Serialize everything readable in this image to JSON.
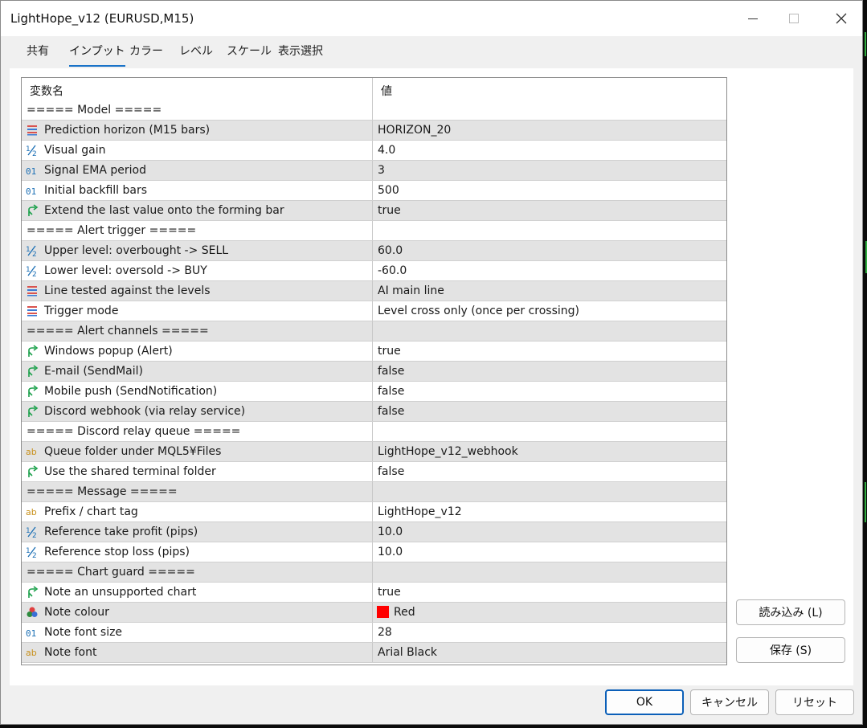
{
  "window": {
    "title": "LightHope_v12 (EURUSD,M15)"
  },
  "tabs": [
    {
      "label": "共有"
    },
    {
      "label": "インプット"
    },
    {
      "label": "カラー"
    },
    {
      "label": "レベル"
    },
    {
      "label": "スケール"
    },
    {
      "label": "表示選択"
    }
  ],
  "active_tab": "インプット",
  "table": {
    "header": {
      "name": "変数名",
      "value": "値"
    },
    "rows": [
      {
        "type": "group",
        "name": "===== Model =====",
        "value": ""
      },
      {
        "type": "enum",
        "name": "Prediction horizon (M15 bars)",
        "value": "HORIZON_20"
      },
      {
        "type": "double",
        "name": "Visual gain",
        "value": "4.0"
      },
      {
        "type": "int",
        "name": "Signal EMA period",
        "value": "3"
      },
      {
        "type": "int",
        "name": "Initial backfill bars",
        "value": "500"
      },
      {
        "type": "bool",
        "name": "Extend the last value onto the forming bar",
        "value": "true"
      },
      {
        "type": "group",
        "name": "===== Alert trigger =====",
        "value": ""
      },
      {
        "type": "double",
        "name": "Upper level: overbought -> SELL",
        "value": "60.0"
      },
      {
        "type": "double",
        "name": "Lower level: oversold -> BUY",
        "value": "-60.0"
      },
      {
        "type": "enum",
        "name": "Line tested against the levels",
        "value": "AI main line"
      },
      {
        "type": "enum",
        "name": "Trigger mode",
        "value": "Level cross only (once per crossing)"
      },
      {
        "type": "group",
        "name": "===== Alert channels =====",
        "value": ""
      },
      {
        "type": "bool",
        "name": "Windows popup (Alert)",
        "value": "true"
      },
      {
        "type": "bool",
        "name": "E-mail (SendMail)",
        "value": "false"
      },
      {
        "type": "bool",
        "name": "Mobile push (SendNotification)",
        "value": "false"
      },
      {
        "type": "bool",
        "name": "Discord webhook (via relay service)",
        "value": "false"
      },
      {
        "type": "group",
        "name": "===== Discord relay queue =====",
        "value": ""
      },
      {
        "type": "string",
        "name": "Queue folder under MQL5¥Files",
        "value": "LightHope_v12_webhook"
      },
      {
        "type": "bool",
        "name": "Use the shared terminal folder",
        "value": "false"
      },
      {
        "type": "group",
        "name": "===== Message =====",
        "value": ""
      },
      {
        "type": "string",
        "name": "Prefix / chart tag",
        "value": "LightHope_v12"
      },
      {
        "type": "double",
        "name": "Reference take profit (pips)",
        "value": "10.0"
      },
      {
        "type": "double",
        "name": "Reference stop loss (pips)",
        "value": "10.0"
      },
      {
        "type": "group",
        "name": "===== Chart guard =====",
        "value": ""
      },
      {
        "type": "bool",
        "name": "Note an unsupported chart",
        "value": "true"
      },
      {
        "type": "color",
        "name": "Note colour",
        "value": "Red",
        "swatch": "#ff0000"
      },
      {
        "type": "int",
        "name": "Note font size",
        "value": "28"
      },
      {
        "type": "string",
        "name": "Note font",
        "value": "Arial Black"
      }
    ]
  },
  "side_buttons": {
    "load": "読み込み (L)",
    "save": "保存 (S)"
  },
  "bottom_buttons": {
    "ok": "OK",
    "cancel": "キャンセル",
    "reset": "リセット"
  },
  "colors": {
    "accent": "#1a73c8",
    "alt_row": "#e3e3e3",
    "bool_icon": "#1aa04a",
    "enum_icon": "#d9534f",
    "num_icon": "#1b6fb5",
    "string_icon": "#c8901a"
  },
  "icons": {
    "enum": "enum-list-icon",
    "double": "fraction-icon",
    "int": "binary-01-icon",
    "bool": "branch-arrow-icon",
    "string": "ab-text-icon",
    "color": "color-circles-icon"
  }
}
